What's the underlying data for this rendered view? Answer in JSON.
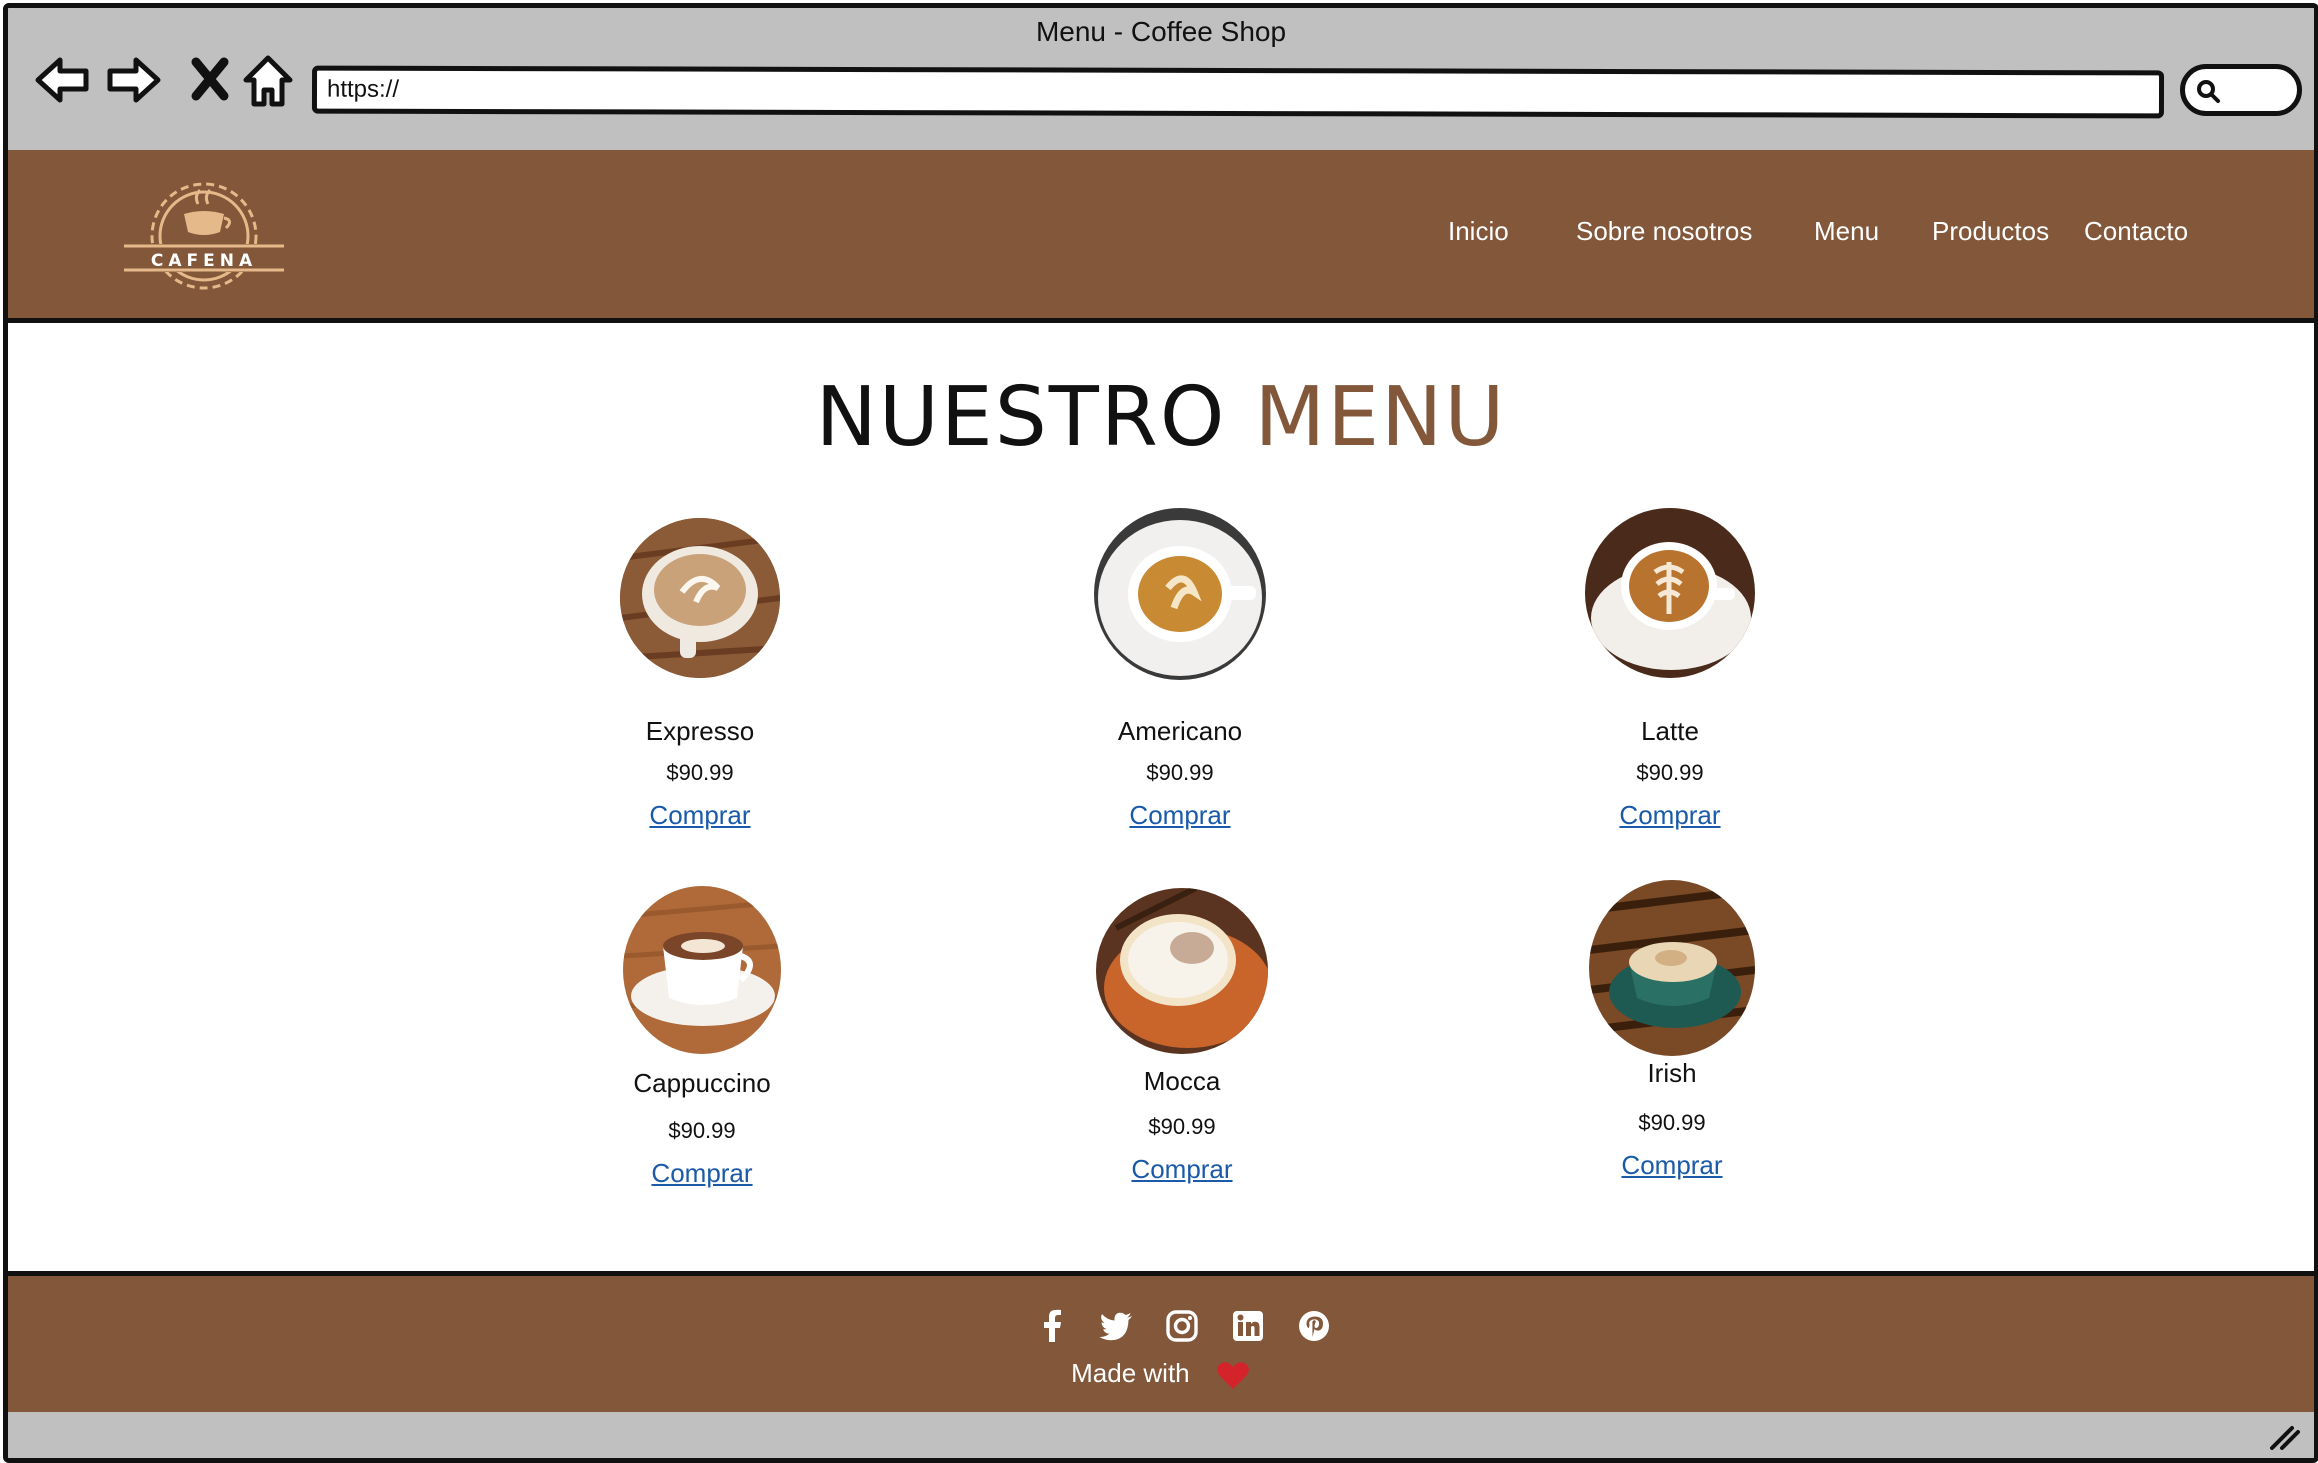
{
  "window": {
    "title": "Menu - Coffee Shop",
    "url": "https://"
  },
  "logo": {
    "text": "CAFENA"
  },
  "nav": [
    {
      "label": "Inicio"
    },
    {
      "label": "Sobre nosotros"
    },
    {
      "label": "Menu"
    },
    {
      "label": "Productos"
    },
    {
      "label": "Contacto"
    }
  ],
  "main": {
    "title_part1": "NUESTRO",
    "title_part2": "MENU",
    "items": [
      {
        "name": "Expresso",
        "price": "$90.99",
        "action": "Comprar"
      },
      {
        "name": "Americano",
        "price": "$90.99",
        "action": "Comprar"
      },
      {
        "name": "Latte",
        "price": "$90.99",
        "action": "Comprar"
      },
      {
        "name": "Cappuccino",
        "price": "$90.99",
        "action": "Comprar"
      },
      {
        "name": "Mocca",
        "price": "$90.99",
        "action": "Comprar"
      },
      {
        "name": "Irish",
        "price": "$90.99",
        "action": "Comprar"
      }
    ]
  },
  "footer": {
    "social_icons": [
      "facebook-icon",
      "twitter-icon",
      "instagram-icon",
      "linkedin-icon",
      "pinterest-icon"
    ],
    "made_with": "Made with"
  },
  "colors": {
    "brand_brown": "#82573a",
    "chrome_gray": "#c0c0c0",
    "link_blue": "#1a5aa8",
    "heart_red": "#d4232a"
  }
}
